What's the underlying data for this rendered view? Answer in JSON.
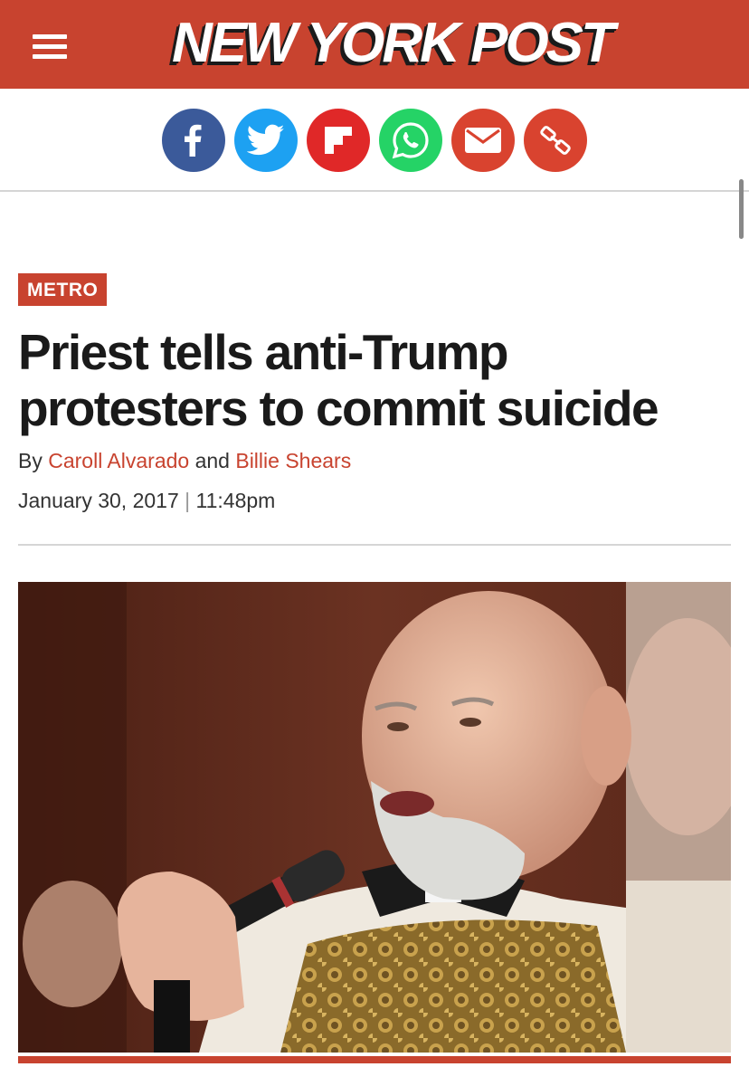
{
  "header": {
    "logo_text": "NEW YORK POST",
    "brand_color": "#c8432f",
    "menu_icon": "hamburger-menu-icon"
  },
  "share": {
    "items": [
      {
        "name": "facebook",
        "icon": "facebook-icon",
        "color": "#3b5a9a"
      },
      {
        "name": "twitter",
        "icon": "twitter-icon",
        "color": "#1da1f2"
      },
      {
        "name": "flipboard",
        "icon": "flipboard-icon",
        "color": "#e02828"
      },
      {
        "name": "whatsapp",
        "icon": "whatsapp-icon",
        "color": "#25d366"
      },
      {
        "name": "email",
        "icon": "email-icon",
        "color": "#d9432f"
      },
      {
        "name": "copy-link",
        "icon": "link-icon",
        "color": "#d9432f"
      }
    ]
  },
  "article": {
    "section": "METRO",
    "headline": "Priest tells anti-Trump protesters to commit suicide",
    "by_prefix": "By",
    "authors": [
      "Caroll Alvarado",
      "Billie Shears"
    ],
    "author_joiner": "and",
    "date": "January 30, 2017",
    "date_separator": "|",
    "time": "11:48pm",
    "image_desc_icon": "priest-photo"
  }
}
